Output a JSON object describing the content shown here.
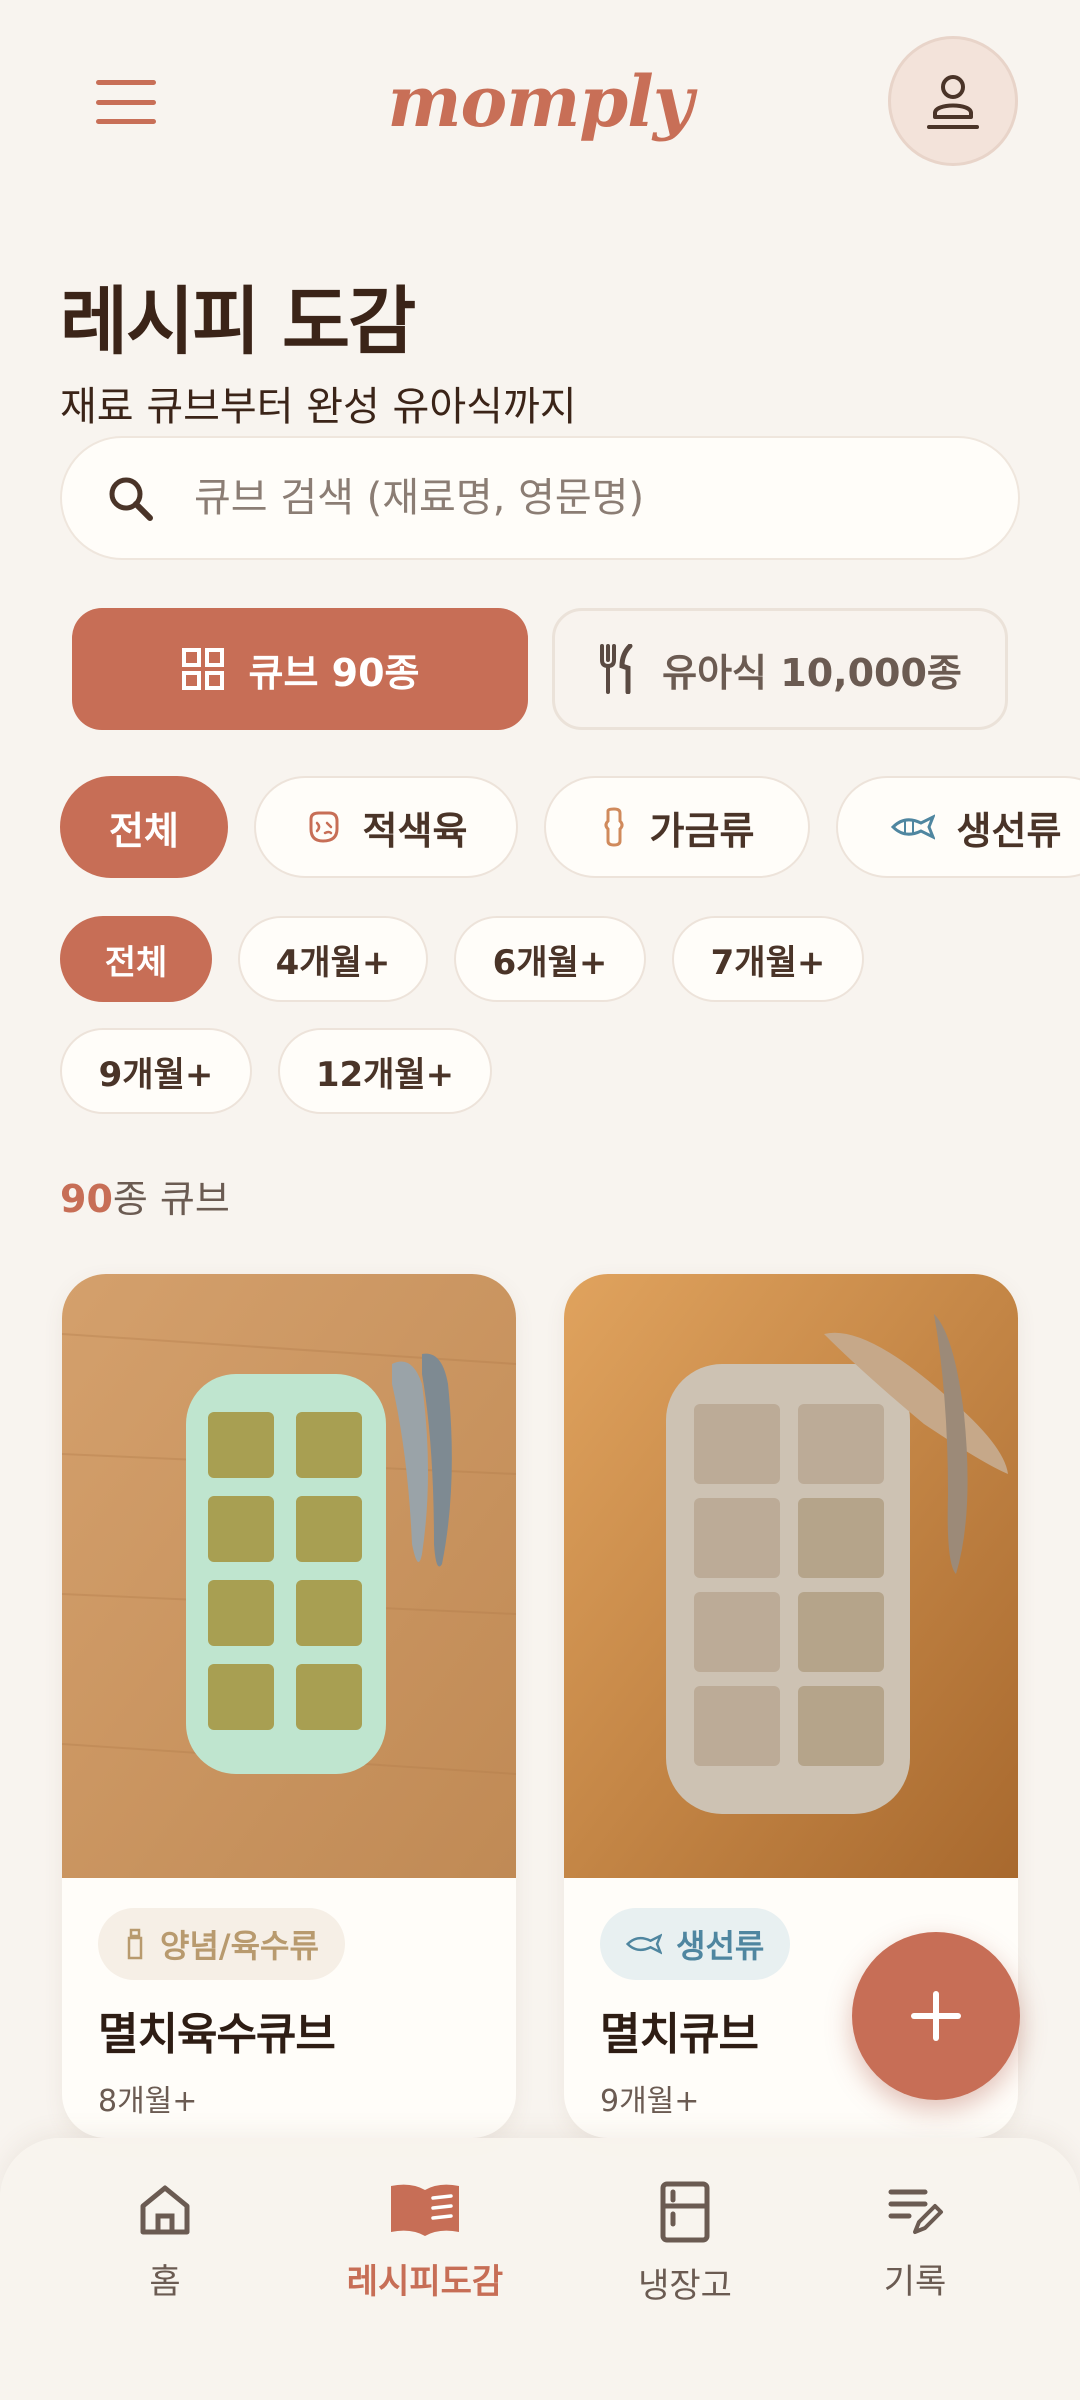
{
  "header": {
    "logo": "momply"
  },
  "page": {
    "title": "레시피 도감",
    "subtitle": "재료 큐브부터 완성 유아식까지"
  },
  "search": {
    "placeholder": "큐브 검색 (재료명, 영문명)"
  },
  "modes": [
    {
      "label": "큐브 90종",
      "icon": "grid-icon",
      "active": true
    },
    {
      "label": "유아식 10,000종",
      "icon": "fork-knife-icon",
      "active": false
    }
  ],
  "categories": [
    {
      "label": "전체",
      "active": true
    },
    {
      "label": "적색육",
      "icon": "meat-icon"
    },
    {
      "label": "가금류",
      "icon": "drumstick-icon"
    },
    {
      "label": "생선류",
      "icon": "fish-icon"
    }
  ],
  "ages": [
    "전체",
    "4개월+",
    "6개월+",
    "7개월+",
    "9개월+",
    "12개월+"
  ],
  "count": {
    "number": "90",
    "suffix": "종 큐브"
  },
  "cards": [
    {
      "tag": "양념/육수류",
      "tag_icon": "bottle-icon",
      "name": "멸치육수큐브",
      "age": "8개월+",
      "tag_color": "#b89a6e",
      "tag_bg": "#f6efe6"
    },
    {
      "tag": "생선류",
      "tag_icon": "fish-icon",
      "name": "멸치큐브",
      "age": "9개월+",
      "tag_color": "#4f86a0",
      "tag_bg": "#e8f0f1"
    }
  ],
  "nav": [
    {
      "label": "홈",
      "icon": "home-icon",
      "active": false
    },
    {
      "label": "레시피도감",
      "icon": "book-icon",
      "active": true
    },
    {
      "label": "냉장고",
      "icon": "fridge-icon",
      "active": false
    },
    {
      "label": "기록",
      "icon": "edit-list-icon",
      "active": false
    }
  ],
  "colors": {
    "accent": "#c76e56",
    "background": "#f8f4ef",
    "text": "#3b2418"
  }
}
